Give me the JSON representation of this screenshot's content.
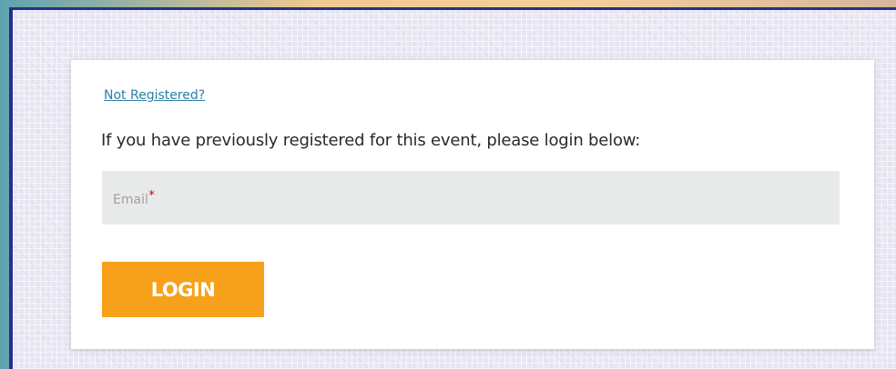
{
  "login_card": {
    "not_registered_link": "Not Registered?",
    "intro_text": "If you have previously registered for this event, please login below:",
    "email_field": {
      "placeholder": "Email",
      "required_mark": "*",
      "value": ""
    },
    "login_button_label": "LOGIN"
  },
  "colors": {
    "button": "#f7a11a",
    "link": "#2b7fa6",
    "required": "#d10000",
    "frame_border": "#28308a"
  }
}
